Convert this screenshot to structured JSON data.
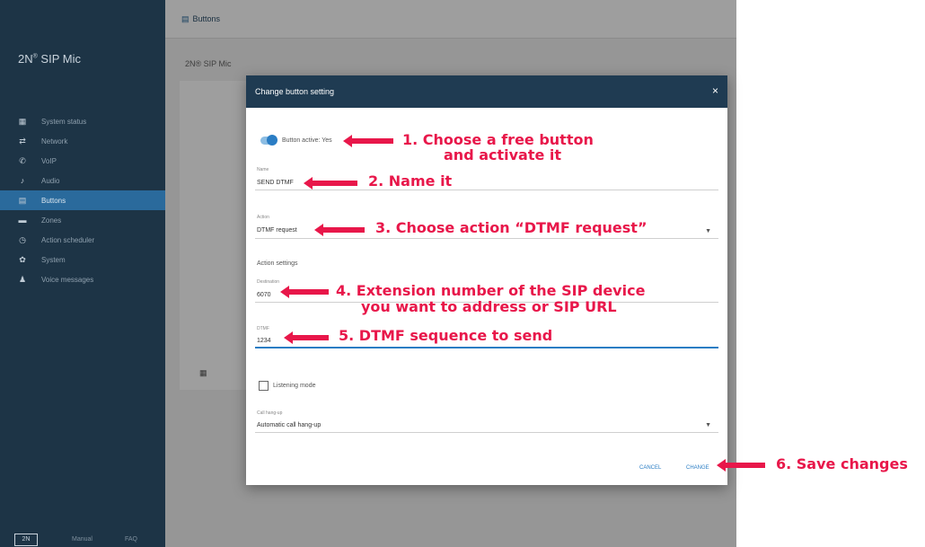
{
  "sidebar": {
    "logo": "2N",
    "logo_sup": "®",
    "logo_rest": " SIP Mic",
    "items": [
      {
        "icon": "grid-icon",
        "glyph": "▦",
        "label": "System status"
      },
      {
        "icon": "network-icon",
        "glyph": "⇄",
        "label": "Network"
      },
      {
        "icon": "phone-icon",
        "glyph": "✆",
        "label": "VoIP"
      },
      {
        "icon": "audio-icon",
        "glyph": "♪",
        "label": "Audio"
      },
      {
        "icon": "buttons-icon",
        "glyph": "▤",
        "label": "Buttons",
        "active": true
      },
      {
        "icon": "zones-icon",
        "glyph": "▬",
        "label": "Zones"
      },
      {
        "icon": "schedule-icon",
        "glyph": "◷",
        "label": "Action scheduler"
      },
      {
        "icon": "gear-icon",
        "glyph": "✿",
        "label": "System"
      },
      {
        "icon": "message-icon",
        "glyph": "♟",
        "label": "Voice messages"
      }
    ],
    "footer": {
      "badge": "2N",
      "link1": "Manual",
      "link2": "FAQ"
    }
  },
  "topbar": {
    "title": "Buttons"
  },
  "page": {
    "subtitle": "2N® SIP Mic"
  },
  "dialog": {
    "title": "Change button setting",
    "close": "×",
    "active_label": "Button active: Yes",
    "name_caption": "Name",
    "name_value": "SEND DTMF",
    "action_caption": "Action",
    "action_value": "DTMF request",
    "action_settings": "Action settings",
    "destination_caption": "Destination",
    "destination_value": "6070",
    "dtmf_caption": "DTMF",
    "dtmf_value": "1234",
    "listening_mode": "Listening mode",
    "hangup_caption": "Call hang-up",
    "hangup_value": "Automatic call hang-up",
    "cancel": "CANCEL",
    "change": "CHANGE"
  },
  "annotations": {
    "a1_line1": "1. Choose a free button",
    "a1_line2": "and activate it",
    "a2": "2. Name it",
    "a3": "3. Choose action “DTMF request”",
    "a4_line1": "4. Extension number of the SIP device",
    "a4_line2": "you want to address or SIP URL",
    "a5": "5. DTMF sequence to send",
    "a6": "6. Save changes"
  },
  "colors": {
    "annotation": "#e8174a",
    "accent": "#2a7dc4",
    "sidebar": "#1d3446"
  }
}
